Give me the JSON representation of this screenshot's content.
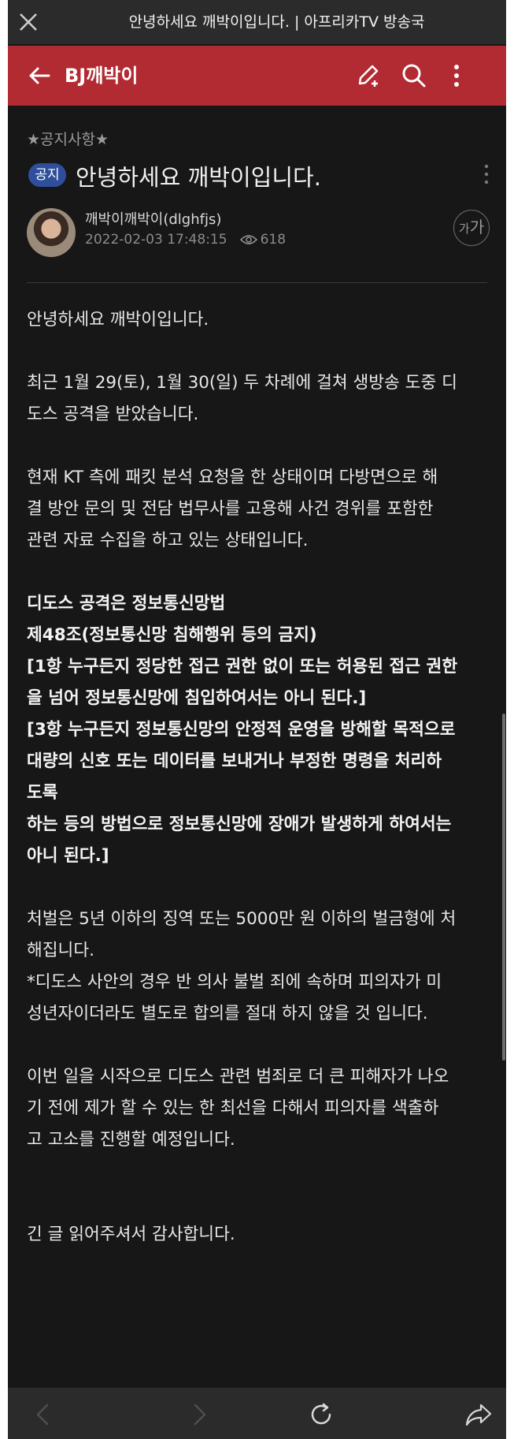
{
  "browser": {
    "title": "안녕하세요 깨박이입니다. | 아프리카TV 방송국"
  },
  "header": {
    "title": "BJ깨박이"
  },
  "post": {
    "category": "★공지사항★",
    "badge": "공지",
    "title": "안녕하세요 깨박이입니다.",
    "author": "깨박이깨박이(dlghfjs)",
    "datetime": "2022-02-03 17:48:15",
    "views": "618",
    "font_size_button_small": "가",
    "font_size_button_large": "가"
  },
  "body": {
    "line1": "안녕하세요 깨박이입니다.",
    "para2": [
      "최근 1월 29(토), 1월 30(일) 두 차례에 걸쳐 생방송 도중 디",
      "도스  공격을 받았습니다."
    ],
    "para3": [
      "현재 KT 측에 패킷 분석 요청을 한 상태이며 다방면으로 해",
      "결 방안 문의 및 전담 법무사를 고용해 사건 경위를 포함한",
      "관련 자료 수집을 하고 있는 상태입니다."
    ],
    "bold": [
      "디도스 공격은 정보통신망법",
      "제48조(정보통신망 침해행위 등의 금지)",
      "[1항 누구든지 정당한 접근 권한 없이 또는 허용된 접근 권한",
      "을 넘어 정보통신망에 침입하여서는 아니 된다.]",
      "[3항 누구든지 정보통신망의 안정적 운영을 방해할 목적으로",
      "대량의 신호 또는 데이터를 보내거나 부정한 명령을 처리하",
      "도록",
      "하는 등의 방법으로 정보통신망에 장애가 발생하게 하여서는",
      "아니 된다.]"
    ],
    "para5": [
      "처벌은 5년 이하의 징역 또는 5000만 원 이하의 벌금형에 처",
      "해집니다.",
      "*디도스 사안의 경우 반 의사 불벌 죄에 속하며 피의자가 미",
      "성년자이더라도 별도로 합의를 절대 하지 않을 것 입니다."
    ],
    "para6": [
      "이번 일을 시작으로 디도스 관련 범죄로 더 큰 피해자가 나오",
      "기 전에 제가 할 수 있는 한 최선을 다해서 피의자를 색출하",
      "고 고소를 진행할 예정입니다."
    ],
    "closing": "긴 글 읽어주셔서 감사합니다."
  },
  "colors": {
    "header_bg": "#b22a32",
    "page_bg": "#171717",
    "badge_bg": "#2f4e9c"
  },
  "icons": {
    "browser": [
      "close-icon"
    ],
    "header": [
      "back-arrow-icon",
      "write-icon",
      "search-icon",
      "more-vertical-icon"
    ],
    "bottom_nav": [
      "back-icon",
      "forward-icon",
      "refresh-icon",
      "share-icon"
    ]
  }
}
